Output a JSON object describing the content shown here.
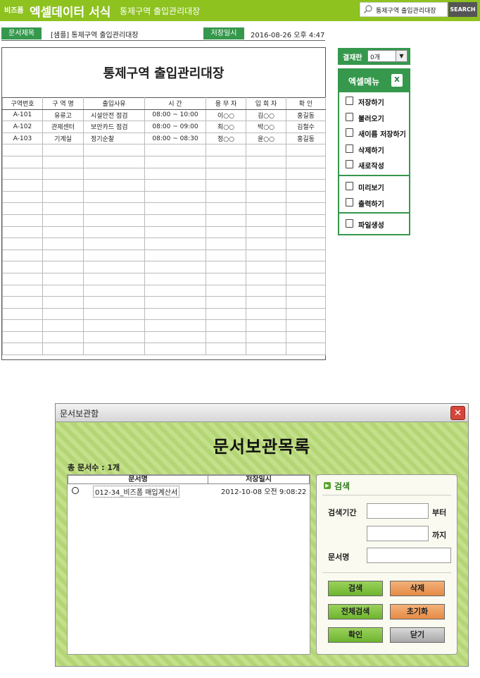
{
  "header": {
    "logo_small": "비즈폼",
    "title": "엑셀데이터 서식",
    "subtitle": "통제구역 출입관리대장",
    "search_value": "통제구역 출입관리대장",
    "search_button": "SEARCH"
  },
  "info": {
    "doc_title_label": "문서제목",
    "doc_title_value": "[샘플] 통제구역 출입관리대장",
    "save_date_label": "저장일시",
    "save_date_value": "2016-08-26  오후 4:47"
  },
  "sheet": {
    "title": "통제구역 출입관리대장",
    "columns": [
      "구역번호",
      "구 역 명",
      "출입사유",
      "시    간",
      "용 무 자",
      "입 회 자",
      "확    인"
    ],
    "rows": [
      [
        "A-101",
        "유류고",
        "시설안전 점검",
        "08:00 ~ 10:00",
        "이○○",
        "김○○",
        "홍길동"
      ],
      [
        "A-102",
        "관제센터",
        "보안카드 점검",
        "08:00 ~ 09:00",
        "최○○",
        "박○○",
        "김철수"
      ],
      [
        "A-103",
        "기계실",
        "정기순찰",
        "08:00 ~ 08:30",
        "정○○",
        "윤○○",
        "홍길동"
      ]
    ],
    "empty_rows": 18
  },
  "side_menu": {
    "approval_label": "결재란",
    "approval_value": "0개",
    "excel_menu_label": "엑셀메뉴",
    "groups": [
      [
        {
          "label": "저장하기",
          "icon": "save-icon"
        },
        {
          "label": "불러오기",
          "icon": "load-icon"
        },
        {
          "label": "새이름 저장하기",
          "icon": "save-as-icon"
        },
        {
          "label": "삭제하기",
          "icon": "trash-icon"
        },
        {
          "label": "새로작성",
          "icon": "new-document-icon"
        }
      ],
      [
        {
          "label": "미리보기",
          "icon": "preview-icon"
        },
        {
          "label": "출력하기",
          "icon": "print-icon"
        }
      ],
      [
        {
          "label": "파일생성",
          "icon": "folder-icon"
        }
      ]
    ]
  },
  "dialog": {
    "title": "문서보관함",
    "heading": "문서보관목록",
    "count": "총 문서수 : 1개",
    "list_columns": [
      "문서명",
      "저장일시"
    ],
    "list_row": {
      "name": "012-34_비즈폼 매입계산서",
      "date": "2012-10-08 오전 9:08:22"
    },
    "search_panel": {
      "title": "검색",
      "period_label": "검색기간",
      "from_label": "부터",
      "to_label": "까지",
      "name_label": "문서명"
    },
    "buttons": {
      "search": "검색",
      "delete": "삭제",
      "search_all": "전체검색",
      "reset": "초기화",
      "ok": "확인",
      "close": "닫기"
    }
  }
}
